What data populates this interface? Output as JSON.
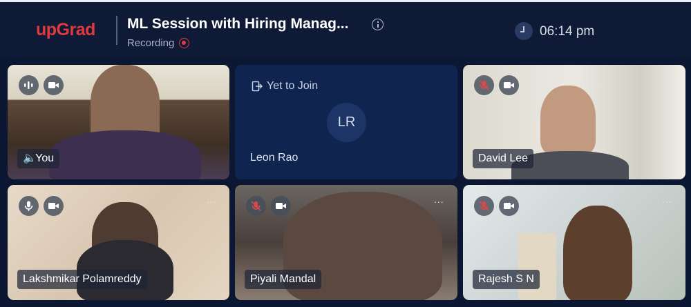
{
  "header": {
    "brand": "upGrad",
    "title": "ML Session with Hiring Manag...",
    "recording_label": "Recording",
    "time": "06:14 pm"
  },
  "tiles": [
    {
      "name": "You",
      "mic": "speaking",
      "camera": "on"
    },
    {
      "name": "Leon Rao",
      "status": "Yet to Join",
      "initials": "LR"
    },
    {
      "name": "David Lee",
      "mic": "muted",
      "camera": "on",
      "menu": "..."
    },
    {
      "name": "Lakshmikar Polamreddy",
      "mic": "on",
      "camera": "on",
      "menu": "..."
    },
    {
      "name": "Piyali Mandal",
      "mic": "muted",
      "camera": "on",
      "menu": "..."
    },
    {
      "name": "Rajesh S N",
      "mic": "muted",
      "camera": "on",
      "menu": "..."
    }
  ],
  "colors": {
    "brand": "#e03a3f",
    "background": "#0b1733",
    "header": "#0e1a36",
    "join_tile": "#0f2550"
  }
}
